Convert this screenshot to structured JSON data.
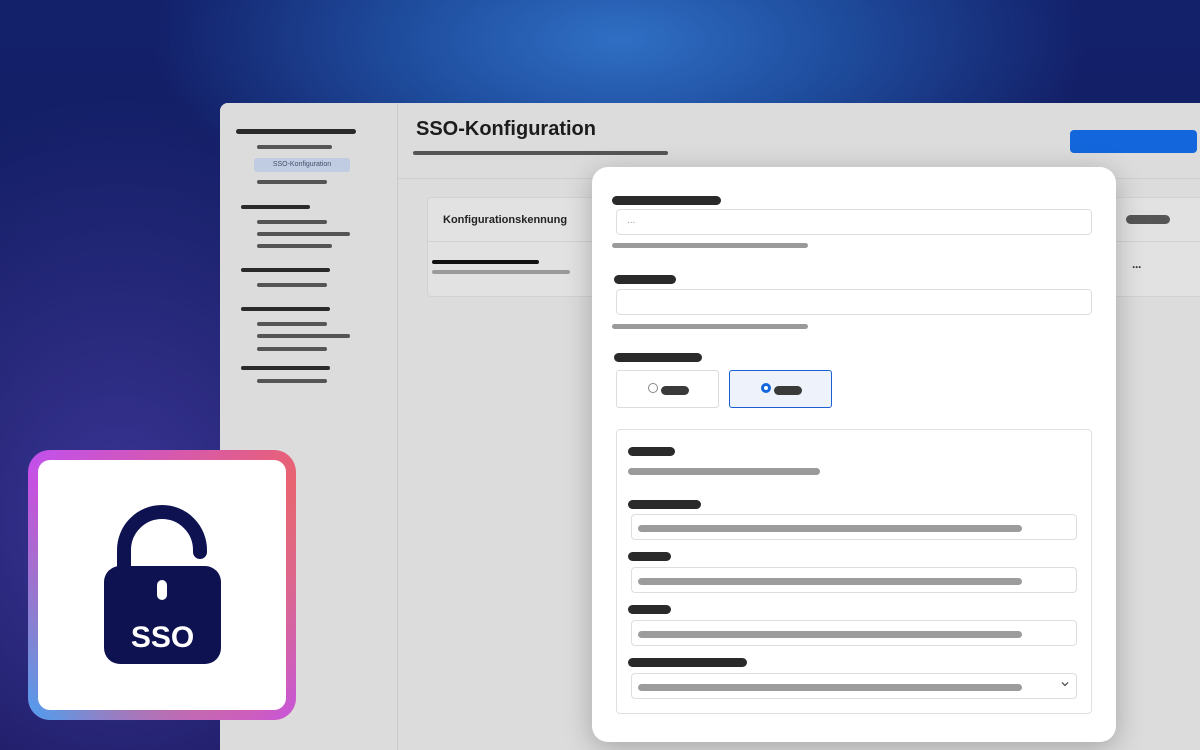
{
  "app": {
    "page_title": "SSO-Konfiguration",
    "sidebar_active_label": "SSO-Konfiguration",
    "table": {
      "column_header": "Konfigurationskennung",
      "row_menu": "···"
    }
  },
  "modal": {
    "field1_placeholder": "..."
  },
  "badge": {
    "label": "SSO",
    "icon": "unlocked-padlock-icon"
  },
  "colors": {
    "primary": "#1466dc",
    "badge_navy": "#0f1250"
  }
}
